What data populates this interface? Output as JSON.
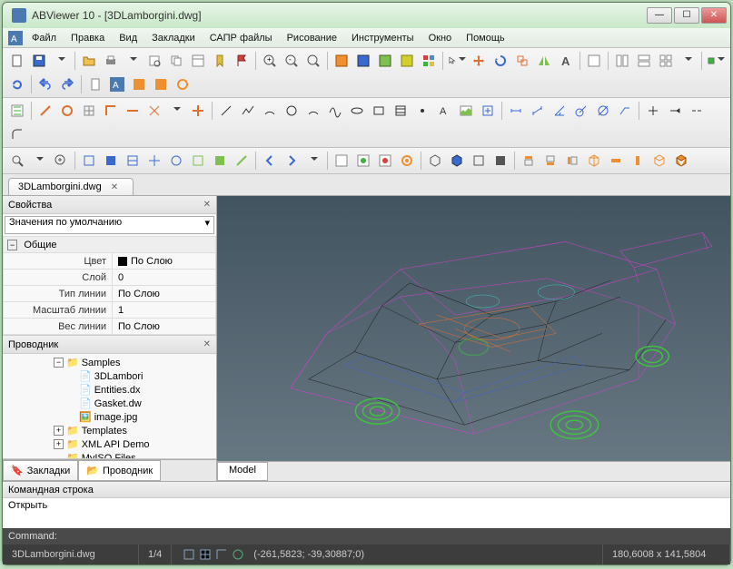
{
  "window": {
    "title": "ABViewer 10 - [3DLamborgini.dwg]"
  },
  "menu": {
    "file": "Файл",
    "edit": "Правка",
    "view": "Вид",
    "bookmarks": "Закладки",
    "sapr": "САПР файлы",
    "draw": "Рисование",
    "tools": "Инструменты",
    "window": "Окно",
    "help": "Помощь"
  },
  "tabs": {
    "document": "3DLamborgini.dwg"
  },
  "properties": {
    "title": "Свойства",
    "defaults_label": "Значения по умолчанию",
    "group_general": "Общие",
    "rows": {
      "color_label": "Цвет",
      "color_value": "По Слою",
      "layer_label": "Слой",
      "layer_value": "0",
      "linetype_label": "Тип линии",
      "linetype_value": "По Слою",
      "linescale_label": "Масштаб линии",
      "linescale_value": "1",
      "lineweight_label": "Вес линии",
      "lineweight_value": "По Слою"
    }
  },
  "explorer": {
    "title": "Проводник",
    "nodes": {
      "samples": "Samples",
      "file1": "3DLambori",
      "file2": "Entities.dx",
      "file3": "Gasket.dw",
      "file4": "image.jpg",
      "templates": "Templates",
      "xmlapi": "XML API Demo",
      "myiso": "MyISO Files"
    }
  },
  "left_tabs": {
    "bookmarks": "Закладки",
    "explorer": "Проводник"
  },
  "model_tab": "Model",
  "cmd": {
    "header": "Командная строка",
    "line": "Открыть"
  },
  "command": {
    "label": "Command:"
  },
  "status": {
    "file": "3DLamborgini.dwg",
    "page": "1/4",
    "coord": "(-261,5823; -39,30887;0)",
    "dims": "180,6008 x 141,5804"
  },
  "icons": {
    "new": "new",
    "open": "open",
    "save": "save",
    "saveall": "saveall",
    "print": "print",
    "preview": "preview",
    "copy": "copy",
    "paste": "paste",
    "undo": "undo",
    "redo": "redo",
    "zoomfit": "zoomfit",
    "zoomin": "zoomin",
    "zoomout": "zoomout"
  }
}
